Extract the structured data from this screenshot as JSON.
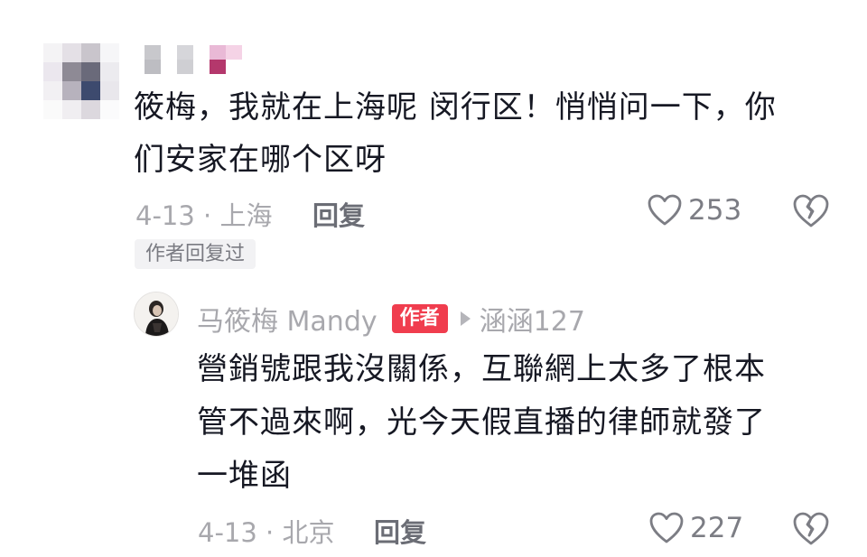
{
  "comment": {
    "text_line1": "筱梅，我就在上海呢 闵行区！悄悄问一下，你",
    "text_line2": "们安家在哪个区呀",
    "date_location": "4-13 · 上海",
    "reply_label": "回复",
    "like_count": "253",
    "author_replied_badge": "作者回复过"
  },
  "reply": {
    "author_name": "马筱梅 Mandy",
    "author_badge": "作者",
    "reply_to": "涵涵127",
    "text_line1": "營銷號跟我沒關係，互聯網上太多了根本",
    "text_line2": "管不過來啊，光今天假直播的律師就發了",
    "text_line3": "一堆函",
    "date_location": "4-13 · 北京",
    "reply_label": "回复",
    "like_count": "227"
  },
  "colors": {
    "text": "#161823",
    "meta": "#a8a8ad",
    "badge": "#f03d4e"
  },
  "icons": [
    "heart-outline-icon",
    "broken-heart-icon",
    "play-triangle-icon"
  ]
}
